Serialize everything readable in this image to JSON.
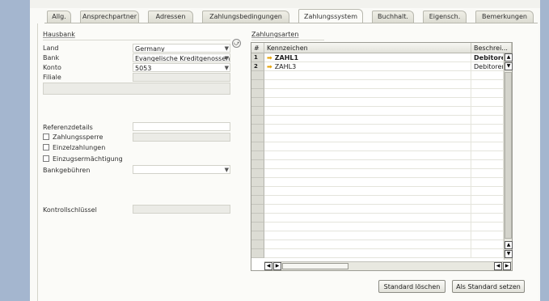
{
  "tabs": [
    {
      "label": "Allg.",
      "active": false
    },
    {
      "label": "Ansprechpartner",
      "active": false
    },
    {
      "label": "Adressen",
      "active": false
    },
    {
      "label": "Zahlungsbedingungen",
      "active": false
    },
    {
      "label": "Zahlungssystem",
      "active": true
    },
    {
      "label": "Buchhalt.",
      "active": false
    },
    {
      "label": "Eigensch.",
      "active": false
    },
    {
      "label": "Bemerkungen",
      "active": false
    }
  ],
  "hausbank": {
    "title": "Hausbank",
    "land_label": "Land",
    "land_value": "Germany",
    "bank_label": "Bank",
    "bank_value": "Evangelische Kreditgenossens",
    "konto_label": "Konto",
    "konto_value": "5053",
    "filiale_label": "Filiale",
    "filiale_value": ""
  },
  "referenz": {
    "referenzdetails_label": "Referenzdetails",
    "referenzdetails_value": "",
    "zahlungssperre_label": "Zahlungssperre",
    "einzelzahlungen_label": "Einzelzahlungen",
    "einzugsermaechtigung_label": "Einzugsermächtigung",
    "bankgebuehren_label": "Bankgebühren",
    "bankgebuehren_value": "",
    "kontrollschluessel_label": "Kontrollschlüssel",
    "kontrollschluessel_value": ""
  },
  "zahlungsarten": {
    "title": "Zahlungsarten",
    "columns": [
      "#",
      "Kennzeichen",
      "Beschrei..."
    ],
    "rows": [
      {
        "num": "1",
        "kennzeichen": "ZAHL1",
        "beschreibung": "Debitoren ZV",
        "bold": true
      },
      {
        "num": "2",
        "kennzeichen": "ZAHL3",
        "beschreibung": "Debitoren ZV",
        "bold": false
      }
    ]
  },
  "buttons": {
    "standard_loeschen": "Standard löschen",
    "als_standard_setzen": "Als Standard setzen"
  },
  "icons": {
    "dropdown": "▼",
    "link_arrow": "➡",
    "scroll_up": "▲",
    "scroll_down": "▼",
    "scroll_left": "◀",
    "scroll_right": "▶",
    "link_button": "⤻"
  },
  "colors": {
    "side_strip": "#a4b6cf",
    "link_arrow": "#e5a000"
  }
}
